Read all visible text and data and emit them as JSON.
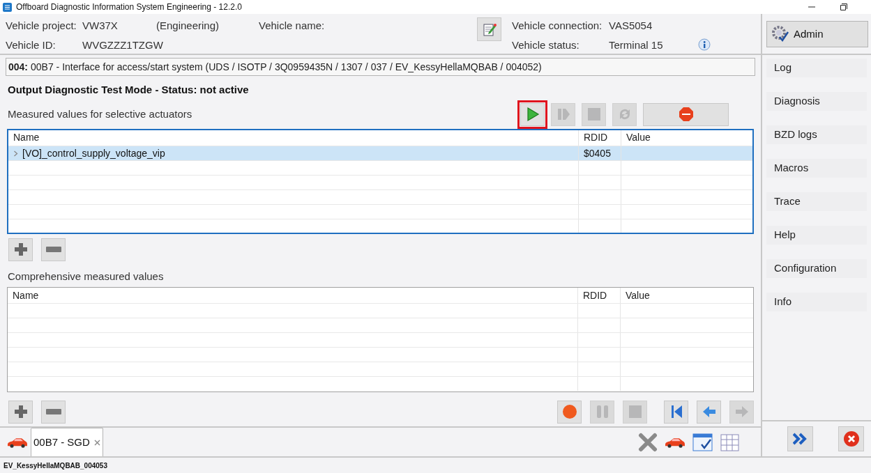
{
  "window": {
    "title": "Offboard Diagnostic Information System Engineering - 12.2.0"
  },
  "vehicle": {
    "fields": [
      {
        "label": "Vehicle project:",
        "value": "VW37X",
        "extra": "(Engineering)"
      },
      {
        "label": "Vehicle ID:",
        "value": "WVGZZZ1TZGW"
      }
    ],
    "name_label": "Vehicle name:",
    "connection": [
      {
        "label": "Vehicle connection:",
        "value": "VAS5054"
      },
      {
        "label": "Vehicle status:",
        "value": "Terminal 15"
      }
    ]
  },
  "ecu": {
    "code": "004:",
    "description": "00B7 - Interface for access/start system  (UDS / ISOTP / 3Q0959435N / 1307 / 037 / EV_KessyHellaMQBAB / 004052)"
  },
  "mode_status": "Output Diagnostic Test Mode - Status: not active",
  "actuators": {
    "title": "Measured values for selective actuators",
    "toolbar": [
      {
        "kind": "play",
        "disabled": false,
        "highlighted": true
      },
      {
        "kind": "step",
        "disabled": true,
        "highlighted": false
      },
      {
        "kind": "stop-square",
        "disabled": true,
        "highlighted": false
      },
      {
        "kind": "refresh",
        "disabled": true,
        "highlighted": false
      },
      {
        "kind": "stop-sign",
        "disabled": false,
        "highlighted": false
      }
    ],
    "columns": [
      "Name",
      "RDID",
      "Value"
    ],
    "rows": [
      {
        "name": "[VO]_control_supply_voltage_vip",
        "rdid": "$0405",
        "expanded": false,
        "selected": true
      }
    ]
  },
  "comprehensive": {
    "title": "Comprehensive measured values",
    "columns": [
      "Name",
      "RDID",
      "Value"
    ]
  },
  "playback": [
    {
      "kind": "record",
      "disabled": false
    },
    {
      "kind": "pause",
      "disabled": true
    },
    {
      "kind": "stop-square",
      "disabled": true
    },
    {
      "kind": "first",
      "disabled": false
    },
    {
      "kind": "back",
      "disabled": false
    },
    {
      "kind": "forward",
      "disabled": true
    }
  ],
  "tabs": [
    {
      "label": "00B7 - SGD",
      "selected": true
    }
  ],
  "sidebar": {
    "admin": "Admin",
    "items": [
      {
        "label": "Log"
      },
      {
        "label": "Diagnosis"
      },
      {
        "label": "BZD logs"
      },
      {
        "label": "Macros"
      },
      {
        "label": "Trace"
      },
      {
        "label": "Help"
      },
      {
        "label": "Configuration"
      },
      {
        "label": "Info"
      }
    ]
  },
  "status_bar": "EV_KessyHellaMQBAB_004053"
}
